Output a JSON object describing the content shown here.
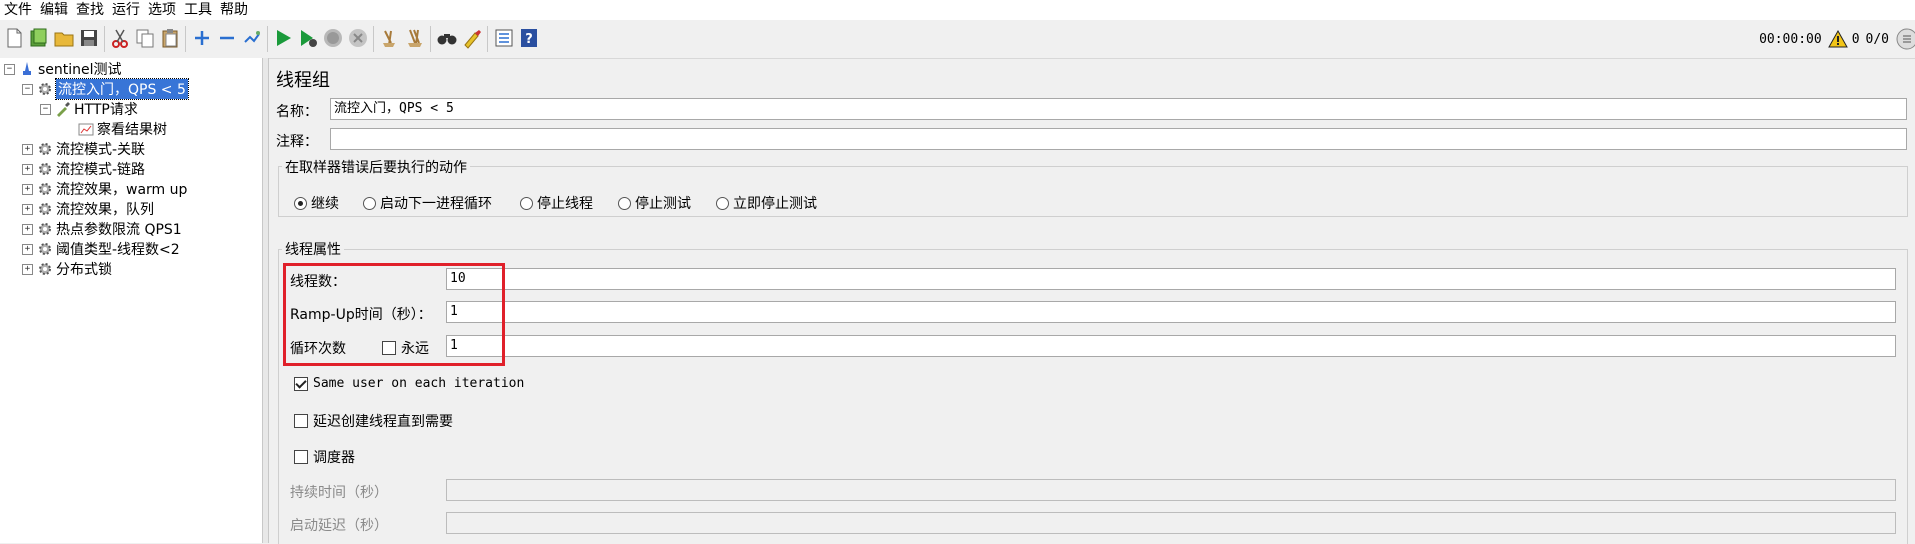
{
  "menu": [
    "文件",
    "编辑",
    "查找",
    "运行",
    "选项",
    "工具",
    "帮助"
  ],
  "status": {
    "timer": "00:00:00",
    "warnings": "0",
    "threads": "0/0"
  },
  "colors": {
    "selection": "#3875d7",
    "highlight_box": "#e0202a",
    "run": "#1a9a3a"
  },
  "tree": [
    {
      "label": "sentinel测试",
      "icon": "test-plan-icon"
    },
    {
      "label": "流控入门，QPS < 5",
      "icon": "gear-icon",
      "selected": true
    },
    {
      "label": "HTTP请求",
      "icon": "pipette-icon"
    },
    {
      "label": "察看结果树",
      "icon": "chart-icon"
    },
    {
      "label": "流控模式-关联",
      "icon": "gear-icon"
    },
    {
      "label": "流控模式-链路",
      "icon": "gear-icon"
    },
    {
      "label": "流控效果，warm up",
      "icon": "gear-icon"
    },
    {
      "label": "流控效果，队列",
      "icon": "gear-icon"
    },
    {
      "label": "热点参数限流 QPS1",
      "icon": "gear-icon"
    },
    {
      "label": "阈值类型-线程数<2",
      "icon": "gear-icon"
    },
    {
      "label": "分布式锁",
      "icon": "gear-icon"
    }
  ],
  "panel": {
    "title": "线程组",
    "name_label": "名称：",
    "name_value": "流控入门，QPS < 5",
    "comment_label": "注释：",
    "comment_value": "",
    "error_group_title": "在取样器错误后要执行的动作",
    "error_actions": [
      {
        "label": "继续",
        "checked": true
      },
      {
        "label": "启动下一进程循环",
        "checked": false
      },
      {
        "label": "停止线程",
        "checked": false
      },
      {
        "label": "停止测试",
        "checked": false
      },
      {
        "label": "立即停止测试",
        "checked": false
      }
    ],
    "props_title": "线程属性",
    "threads_label": "线程数：",
    "threads_value": "10",
    "rampup_label": "Ramp-Up时间（秒）：",
    "rampup_value": "1",
    "loop_label": "循环次数",
    "forever_label": "永远",
    "forever_checked": false,
    "loop_value": "1",
    "same_user_label": "Same user on each iteration",
    "same_user_checked": true,
    "delay_label": "延迟创建线程直到需要",
    "delay_checked": false,
    "scheduler_label": "调度器",
    "scheduler_checked": false,
    "duration_label": "持续时间（秒）",
    "startup_delay_label": "启动延迟（秒）"
  }
}
